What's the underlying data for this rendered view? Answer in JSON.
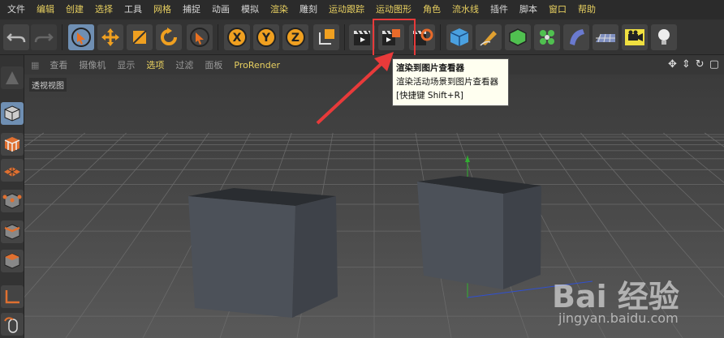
{
  "menubar": {
    "items": [
      {
        "label": "文件",
        "color": "white"
      },
      {
        "label": "编辑",
        "color": "yellow"
      },
      {
        "label": "创建",
        "color": "yellow"
      },
      {
        "label": "选择",
        "color": "yellow"
      },
      {
        "label": "工具",
        "color": "white"
      },
      {
        "label": "网格",
        "color": "yellow"
      },
      {
        "label": "捕捉",
        "color": "white"
      },
      {
        "label": "动画",
        "color": "white"
      },
      {
        "label": "模拟",
        "color": "white"
      },
      {
        "label": "渲染",
        "color": "yellow"
      },
      {
        "label": "雕刻",
        "color": "white"
      },
      {
        "label": "运动跟踪",
        "color": "yellow"
      },
      {
        "label": "运动图形",
        "color": "yellow"
      },
      {
        "label": "角色",
        "color": "yellow"
      },
      {
        "label": "流水线",
        "color": "yellow"
      },
      {
        "label": "插件",
        "color": "white"
      },
      {
        "label": "脚本",
        "color": "white"
      },
      {
        "label": "窗口",
        "color": "yellow"
      },
      {
        "label": "帮助",
        "color": "yellow"
      }
    ]
  },
  "toolbar": {
    "axis_x": "X",
    "axis_y": "Y",
    "axis_z": "Z"
  },
  "viewport_header": {
    "menus": [
      "查看",
      "摄像机",
      "显示",
      "选项",
      "过滤",
      "面板"
    ],
    "active_menu": "选项",
    "prorender": "ProRender"
  },
  "viewport": {
    "label": "透视视图"
  },
  "tooltip": {
    "title": "渲染到图片查看器",
    "description": "渲染活动场景到图片查看器",
    "shortcut": "[快捷键 Shift+R]"
  },
  "watermark": {
    "brand": "Bai 经验",
    "url": "jingyan.baidu.com"
  },
  "colors": {
    "menu_yellow": "#e8d060",
    "pressed_blue": "#6f8fb3",
    "highlight_red": "#e83a3a",
    "cube_face": "#4a5058"
  }
}
